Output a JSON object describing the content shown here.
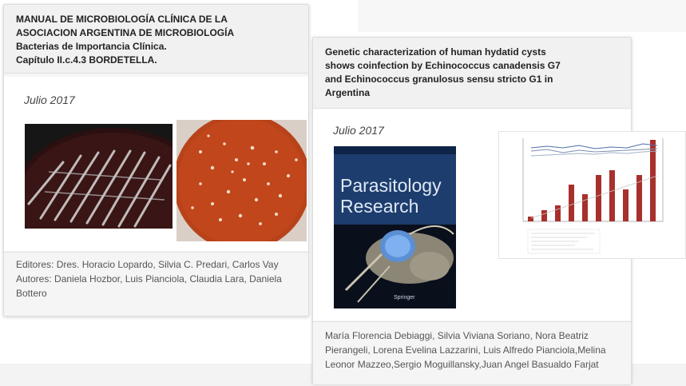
{
  "card1": {
    "title_line1": "MANUAL DE MICROBIOLOGÍA CLÍNICA DE LA",
    "title_line2": "ASOCIACION ARGENTINA DE MICROBIOLOGÍA",
    "title_line3": "Bacterias de Importancia Clínica.",
    "title_line4": "Capítulo II.c.4.3 BORDETELLA.",
    "date": "Julio 2017",
    "footer_line1": "Editores: Dres. Horacio Lopardo, Silvia C. Predari, Carlos Vay",
    "footer_line2": "Autores: Daniela Hozbor, Luis Pianciola, Claudia Lara, Daniela",
    "footer_line3": "Bottero"
  },
  "card2": {
    "title_line1": "Genetic characterization of human hydatid cysts",
    "title_line2": "shows coinfection by Echinococcus canadensis G7",
    "title_line3": "and Echinococcus granulosus sensu stricto G1 in",
    "title_line4": "Argentina",
    "date": "Julio 2017",
    "journal_line1": "Parasitology",
    "journal_line2": "Research",
    "publisher": "Springer",
    "footer_line1": "María Florencia Debiaggi, Silvia Viviana Soriano, Nora Beatriz",
    "footer_line2": "Pierangeli, Lorena Evelina Lazzarini, Luis Alfredo Pianciola,Melina",
    "footer_line3": "Leonor Mazzeo,Sergio Moguillansky,Juan Angel Basualdo Farjat"
  },
  "colors": {
    "plate_red": "#c1461c",
    "journal_blue": "#1d3d6e",
    "bar_red": "#a8302c"
  }
}
